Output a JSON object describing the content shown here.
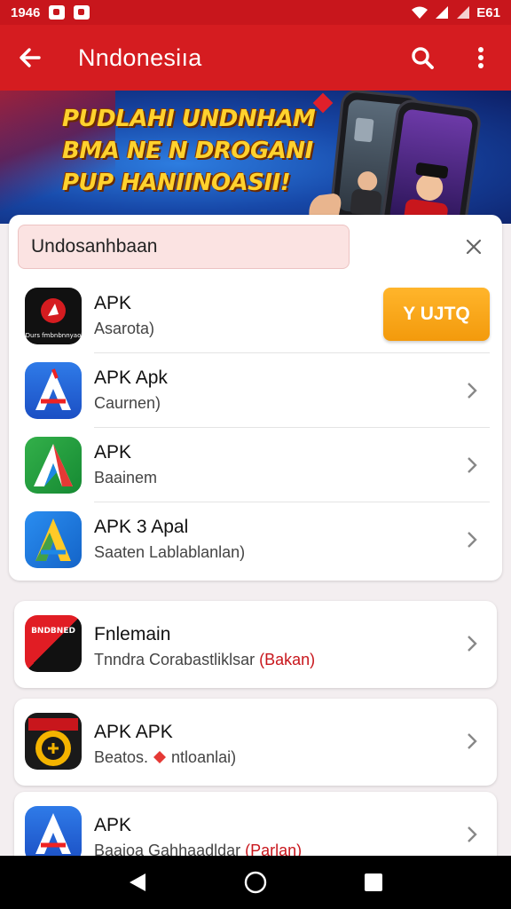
{
  "status_bar": {
    "time": "1946",
    "battery": "E61"
  },
  "app_bar": {
    "title": "Nndonesiıa"
  },
  "banner": {
    "line1": "PUDLAHI UNDNHAM",
    "line2": "BMA NE N DROGANI",
    "line3": "PUP HANIINOASII!"
  },
  "search": {
    "value": "Undosanhbaan"
  },
  "list": [
    {
      "name": "APK",
      "sub": "Asarota)",
      "icon": "red-app-icon",
      "icon_text": "Durs fmbnbnnyao",
      "action": "Y UJTQ"
    },
    {
      "name": "APK Apk",
      "sub": "Caurnen)",
      "icon": "blue-a-icon"
    },
    {
      "name": "APK",
      "sub": "Baainem",
      "icon": "green-a-icon"
    },
    {
      "name": "APK 3 Apal",
      "sub": "Saaten Lablablanlan)",
      "icon": "multicolor-a-icon"
    }
  ],
  "cards": [
    {
      "name": "Fnlemain",
      "sub": "Tnndra Corabastliklsar ",
      "sub_highlight": "(Bakan)",
      "icon": "red-black-icon",
      "icon_text": "BNDBNED"
    },
    {
      "name": "APK APK",
      "sub_pre": "Beatos. ",
      "sub_post": " ntloanlai)",
      "icon": "badge-icon"
    },
    {
      "name": "APK",
      "sub": "Baaioa Gahhaadldar ",
      "sub_highlight": "(Parlan)",
      "icon": "blue-a-icon"
    }
  ],
  "colors": {
    "brand_red": "#d51c20",
    "status_red": "#c8161c",
    "install_orange": "#f5a312",
    "banner_text": "#ffd22e"
  }
}
